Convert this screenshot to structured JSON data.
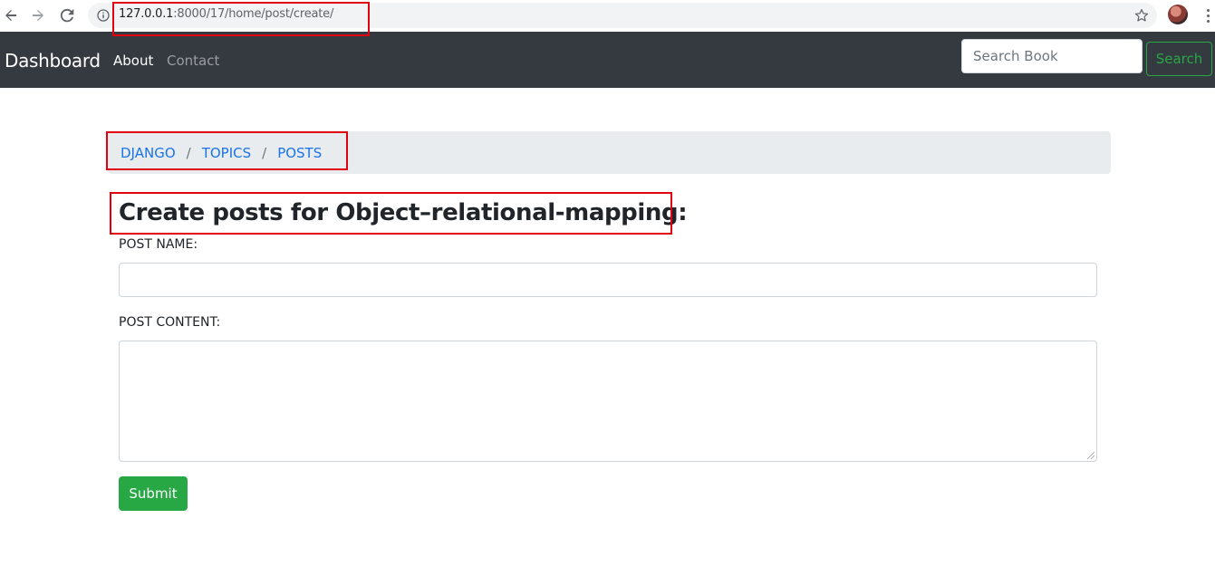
{
  "browser": {
    "url_host": "127.0.0.1",
    "url_rest": ":8000/17/home/post/create/",
    "icons": [
      "back-arrow-icon",
      "forward-arrow-icon",
      "reload-icon",
      "info-icon",
      "star-icon",
      "kebab-menu-icon"
    ]
  },
  "navbar": {
    "brand": "Dashboard",
    "links": [
      "About",
      "Contact"
    ],
    "search": {
      "placeholder": "Search Book",
      "value": "",
      "button_label": "Search"
    },
    "colors": {
      "background": "#343a40",
      "accent": "#28a745"
    }
  },
  "breadcrumb": {
    "items": [
      "DJANGO",
      "TOPICS",
      "POSTS"
    ],
    "separator": "/"
  },
  "form": {
    "heading": "Create posts for Object–relational-mapping:",
    "post_name_label": "POST NAME:",
    "post_name_value": "",
    "post_content_label": "POST CONTENT:",
    "post_content_value": "",
    "submit_label": "Submit"
  },
  "highlight_color": "#e0000f"
}
